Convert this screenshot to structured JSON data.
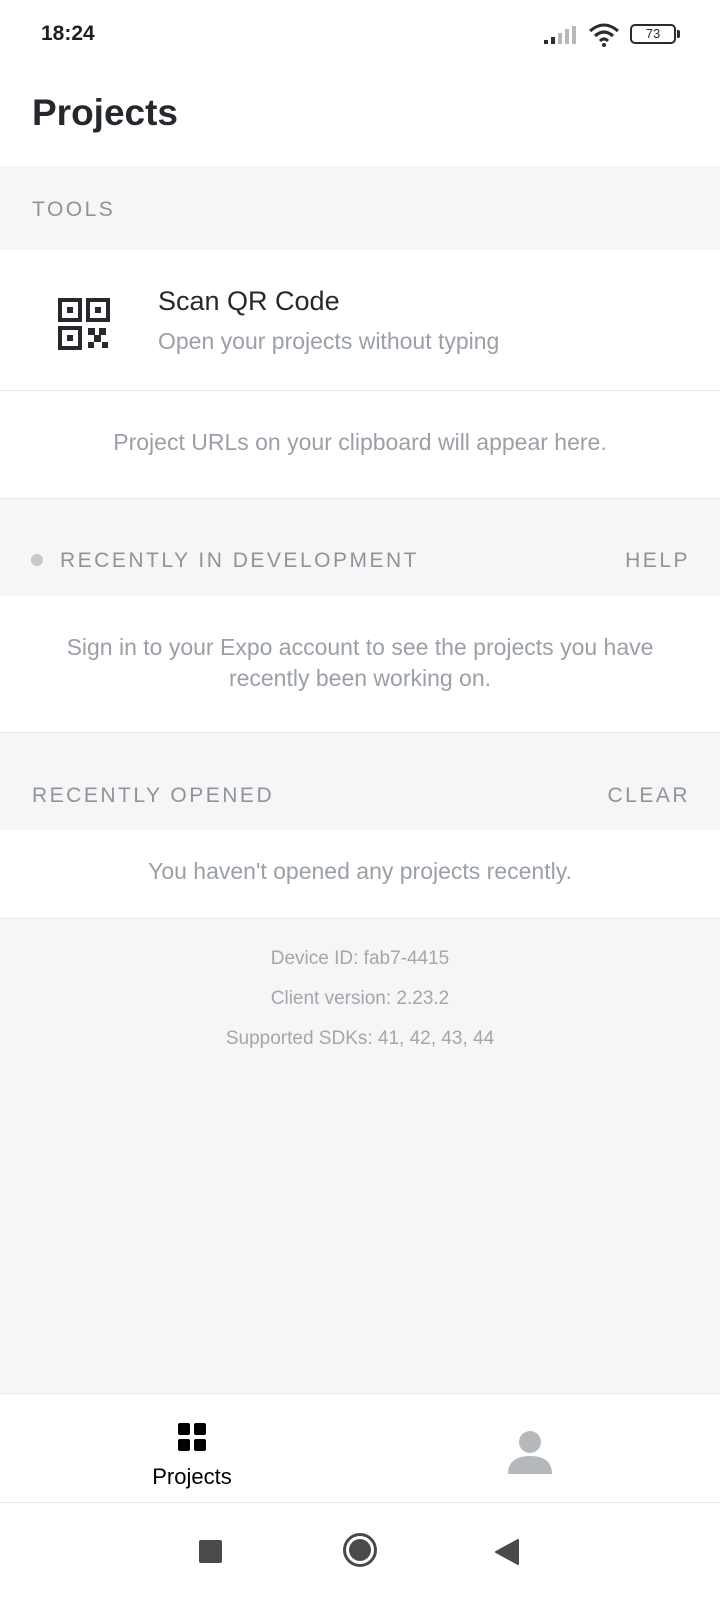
{
  "status_bar": {
    "time": "18:24",
    "battery": "73"
  },
  "header": {
    "title": "Projects"
  },
  "tools": {
    "section_label": "TOOLS",
    "scan": {
      "title": "Scan QR Code",
      "subtitle": "Open your projects without typing",
      "icon": "qr-code-icon"
    },
    "clipboard_hint": "Project URLs on your clipboard will appear here."
  },
  "recently_in_development": {
    "section_label": "RECENTLY IN DEVELOPMENT",
    "action": "HELP",
    "message": "Sign in to your Expo account to see the projects you have recently been working on."
  },
  "recently_opened": {
    "section_label": "RECENTLY OPENED",
    "action": "CLEAR",
    "message": "You haven't opened any projects recently."
  },
  "info": {
    "device_id": "Device ID: fab7-4415",
    "client_version": "Client version: 2.23.2",
    "supported_sdks": "Supported SDKs: 41, 42, 43, 44"
  },
  "tab_bar": {
    "projects_label": "Projects",
    "projects_icon": "grid-icon",
    "profile_icon": "person-icon"
  },
  "colors": {
    "background": "#f6f6f7",
    "text_primary": "#25292e",
    "text_muted": "#9aa0a6"
  }
}
